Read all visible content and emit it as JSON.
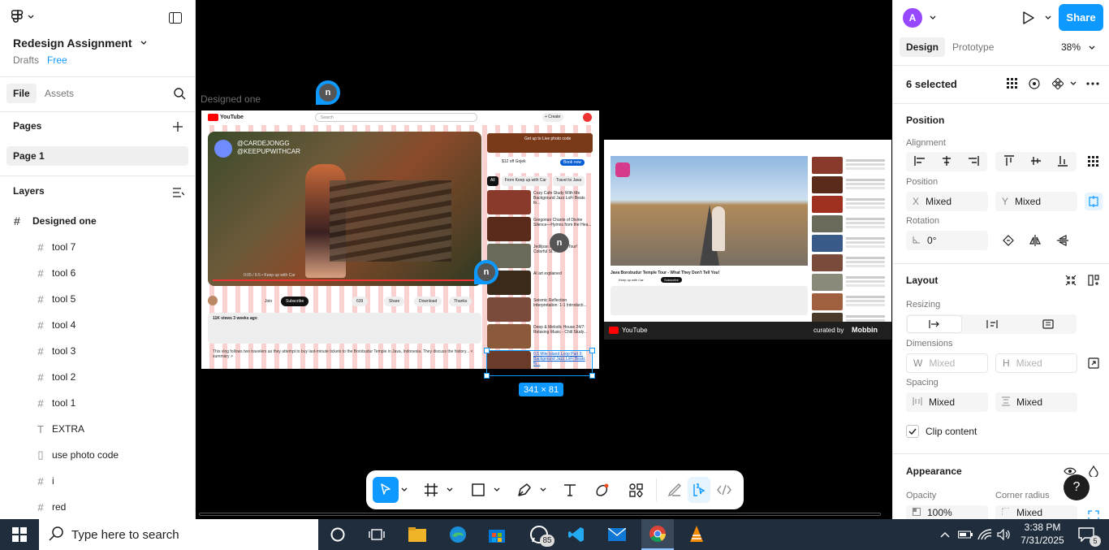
{
  "file": {
    "name": "Redesign Assignment",
    "location": "Drafts",
    "plan": "Free"
  },
  "left_tabs": {
    "file": "File",
    "assets": "Assets"
  },
  "pages": {
    "title": "Pages",
    "items": [
      "Page 1"
    ]
  },
  "layers": {
    "title": "Layers",
    "frame": "Designed one",
    "items": [
      {
        "type": "frame",
        "name": "tool 7"
      },
      {
        "type": "frame",
        "name": "tool 6"
      },
      {
        "type": "frame",
        "name": "tool 5"
      },
      {
        "type": "frame",
        "name": "tool 4"
      },
      {
        "type": "frame",
        "name": "tool 3"
      },
      {
        "type": "frame",
        "name": "tool 2"
      },
      {
        "type": "frame",
        "name": "tool 1"
      },
      {
        "type": "text",
        "name": "EXTRA"
      },
      {
        "type": "component",
        "name": "use photo code"
      },
      {
        "type": "frame",
        "name": "i"
      },
      {
        "type": "frame",
        "name": "red"
      }
    ]
  },
  "canvas": {
    "frame_label": "Designed one",
    "selection_size": "341 × 81",
    "avatar_letter": "n",
    "mock1": {
      "yt_logo": "YouTube",
      "search": "Search",
      "create": "+ Create",
      "channel1": "@CARDEJONGG",
      "channel2": "@KEEPUPWITHCAR",
      "views": "11K views 3 weeks ago",
      "subscribe": "Subscribe",
      "download": "Download",
      "thanks": "Thanks",
      "share": "Share",
      "likes": "639",
      "join": "Join",
      "desc": "This vlog follows two travelers as they attempt to buy last-minute tickets to the Borobudur Temple in Java, Indonesia. They discuss the history... < summary >",
      "player_time": "0:05 / 6:5 • Keep up with Car",
      "chips": [
        "All",
        "From Keep up with Car",
        "Travel to Java"
      ],
      "ad_label": "Get up to Live photo code",
      "ad_sub": "$12 off Gojek",
      "ad_cta": "Book now",
      "recs": [
        "Cozy Cafe Study With Me Background Jazz LoFi Beats fo...",
        "Gregorian Chants of Divine Silence—Hymns from the Hea...",
        "Jedilpan Indonesia Tour! Colorful Sl...",
        "AI art explained",
        "Seismic Reflection Interpretation: 1-1 Introducti...",
        "Deep & Melodic House 24/7: Relaxing Music - Chill Study...",
        "0.5 Mile Island Loop Part II: Background Jazz LoFi Beats fo..."
      ]
    },
    "mock2": {
      "title": "Java Borobudur Temple Tour - What They Don't Tell You!",
      "channel": "Keep up with Car",
      "subscribe": "Subscribe",
      "footer_logo": "YouTube",
      "footer_credit": "curated by",
      "footer_brand": "Mobbin"
    }
  },
  "toolbar": {
    "tools": [
      "move-tool",
      "frame-tool",
      "rectangle-tool",
      "pen-tool",
      "text-tool",
      "shape-builder-tool",
      "components-tool",
      "draw-mode",
      "design-mode",
      "dev-mode"
    ]
  },
  "right": {
    "avatar": "A",
    "share": "Share",
    "tab_design": "Design",
    "tab_prototype": "Prototype",
    "zoom": "38%",
    "selection": "6 selected",
    "position_title": "Position",
    "alignment_label": "Alignment",
    "position_label": "Position",
    "x_prefix": "X",
    "x_value": "Mixed",
    "y_prefix": "Y",
    "y_value": "Mixed",
    "rotation_label": "Rotation",
    "rotation_value": "0°",
    "layout_title": "Layout",
    "resizing_label": "Resizing",
    "dimensions_label": "Dimensions",
    "w_prefix": "W",
    "w_value": "Mixed",
    "h_prefix": "H",
    "h_value": "Mixed",
    "spacing_label": "Spacing",
    "spacing_h": "Mixed",
    "spacing_v": "Mixed",
    "clip_content": "Clip content",
    "appearance_title": "Appearance",
    "opacity_label": "Opacity",
    "opacity_value": "100%",
    "radius_label": "Corner radius",
    "radius_value": "Mixed"
  },
  "taskbar": {
    "search_placeholder": "Type here to search",
    "whatsapp_badge": "85",
    "time": "3:38 PM",
    "date": "7/31/2025",
    "notif_badge": "5"
  },
  "colors": {
    "accent": "#0d99ff",
    "taskbar": "#1f2d3d",
    "yt_red": "#ff0000"
  }
}
